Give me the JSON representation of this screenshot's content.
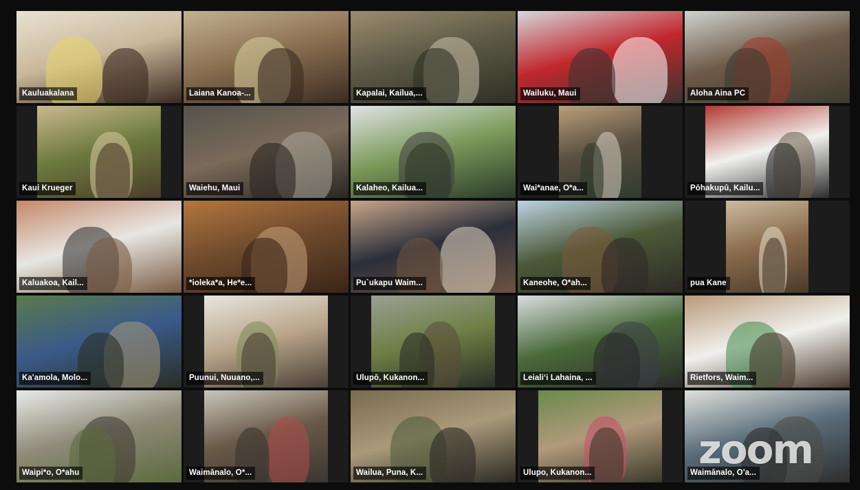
{
  "app": {
    "watermark": "zoom"
  },
  "colors": {
    "active_speaker_border": "#9bd34a",
    "background": "#0c0c0c"
  },
  "participants": [
    {
      "name": "Kauluakalana",
      "layout": "full",
      "active": true,
      "tones": [
        "#e8e2d2",
        "#c9b79a",
        "#e7d46a",
        "#3a2a20"
      ]
    },
    {
      "name": "Laiana Kanoa-...",
      "layout": "full",
      "tones": [
        "#c2b28e",
        "#8a6f50",
        "#d8cfa0",
        "#3b2c22"
      ]
    },
    {
      "name": "Kapalai, Kailua,...",
      "layout": "full",
      "tones": [
        "#9b8c6e",
        "#5b5845",
        "#c8c0a8",
        "#2e3024"
      ]
    },
    {
      "name": "Wailuku, Maui",
      "layout": "full",
      "tones": [
        "#d4d7dc",
        "#c1272d",
        "#ffffff",
        "#3a3430"
      ]
    },
    {
      "name": "Aloha Aina PC",
      "layout": "full",
      "tones": [
        "#cfd3cf",
        "#6e5a48",
        "#a03a2a",
        "#3e3a30"
      ]
    },
    {
      "name": "Kaui Krueger",
      "layout": "pillar",
      "tones": [
        "#c9b98f",
        "#6d7a3e",
        "#d9c9a0",
        "#4b3d2a"
      ]
    },
    {
      "name": "Waiehu, Maui",
      "layout": "full",
      "tones": [
        "#55534c",
        "#7a6a5a",
        "#aaa59a",
        "#2a2622"
      ]
    },
    {
      "name": "Kalaheo, Kailua...",
      "layout": "full",
      "tones": [
        "#dfe3e6",
        "#7c9a5a",
        "#3e3d42",
        "#2b3a2a"
      ]
    },
    {
      "name": "Wai*anae, O*a...",
      "layout": "narrow",
      "tones": [
        "#b99f78",
        "#5a5043",
        "#d8d0c2",
        "#2f3a2c"
      ]
    },
    {
      "name": "Pōhakupū, Kailu...",
      "layout": "pillar",
      "tones": [
        "#b23b32",
        "#f1f1ef",
        "#6b5d4a",
        "#2d2d2d"
      ]
    },
    {
      "name": "Kaluakoa, Kail...",
      "layout": "full",
      "tones": [
        "#c4886a",
        "#e8e6e2",
        "#2a2a2a",
        "#7a5c44"
      ]
    },
    {
      "name": "*ioleka*a, He*e...",
      "layout": "full",
      "tones": [
        "#b3763f",
        "#6e4a2c",
        "#c9a07a",
        "#3a2518"
      ]
    },
    {
      "name": "Pu`ukapu Waim...",
      "layout": "full",
      "tones": [
        "#c9a68a",
        "#2b2f3a",
        "#e7d8c5",
        "#6d5340"
      ]
    },
    {
      "name": "Kaneohe, O*ah...",
      "layout": "full",
      "tones": [
        "#bcd2e2",
        "#4c5a38",
        "#7a5a3c",
        "#2e2a26"
      ]
    },
    {
      "name": "pua Kane",
      "layout": "narrow",
      "tones": [
        "#cbbba0",
        "#8a6b4c",
        "#e6dccb",
        "#4a3a2a"
      ]
    },
    {
      "name": "Ka'amola, Molo...",
      "layout": "full",
      "tones": [
        "#5a7a4a",
        "#3a5a8a",
        "#a89a7a",
        "#2a2e24"
      ]
    },
    {
      "name": "Puunui, Nuuano,...",
      "layout": "pillar",
      "tones": [
        "#e8e6e0",
        "#b9a58a",
        "#7a8a5a",
        "#4a4036"
      ]
    },
    {
      "name": "Ulupō, Kukanon...",
      "layout": "pillar",
      "tones": [
        "#9aa094",
        "#6f7f45",
        "#5a4a3a",
        "#2a2e26"
      ]
    },
    {
      "name": "Leialiʻi Lahaina, ...",
      "layout": "full",
      "tones": [
        "#d9dde0",
        "#4a6a3a",
        "#3a3e48",
        "#2a2a2a"
      ]
    },
    {
      "name": "Rietfors, Waim...",
      "layout": "full",
      "tones": [
        "#b89a7a",
        "#f1f0ec",
        "#3e8a4a",
        "#4a3a2e"
      ]
    },
    {
      "name": "Waipi*o, O*ahu",
      "layout": "full",
      "tones": [
        "#e8ebe8",
        "#8f8a78",
        "#3a3430",
        "#5b6a3e"
      ]
    },
    {
      "name": "Waimānalo, O*...",
      "layout": "pillar",
      "tones": [
        "#c9c6bc",
        "#6a5a48",
        "#b04a4a",
        "#3a3630"
      ]
    },
    {
      "name": "Wailua, Puna, K...",
      "layout": "full",
      "tones": [
        "#7a6a50",
        "#a99a7a",
        "#4a5a3a",
        "#2c2a24"
      ]
    },
    {
      "name": "Ulupo, Kukanon...",
      "layout": "pillar",
      "tones": [
        "#6a8a4a",
        "#b09a7c",
        "#c94a6a",
        "#3a3a2a"
      ]
    },
    {
      "name": "Waimānalo, O'a...",
      "layout": "full",
      "tones": [
        "#dfe1dc",
        "#5a6d7a",
        "#4a4a44",
        "#2e2e2e"
      ]
    }
  ]
}
